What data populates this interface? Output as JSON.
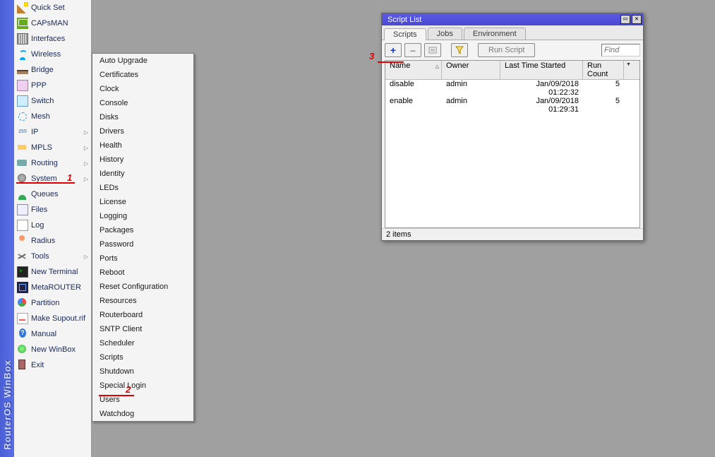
{
  "brand": "RouterOS WinBox",
  "sidebar": [
    {
      "label": "Quick Set",
      "icon": "ic-wand",
      "arrow": false
    },
    {
      "label": "CAPsMAN",
      "icon": "ic-cap",
      "arrow": false
    },
    {
      "label": "Interfaces",
      "icon": "ic-ifc",
      "arrow": false
    },
    {
      "label": "Wireless",
      "icon": "ic-wifi",
      "arrow": false
    },
    {
      "label": "Bridge",
      "icon": "ic-bridge",
      "arrow": false
    },
    {
      "label": "PPP",
      "icon": "ic-ppp",
      "arrow": false
    },
    {
      "label": "Switch",
      "icon": "ic-switch",
      "arrow": false
    },
    {
      "label": "Mesh",
      "icon": "ic-mesh",
      "arrow": false
    },
    {
      "label": "IP",
      "icon": "ic-ip",
      "arrow": true
    },
    {
      "label": "MPLS",
      "icon": "ic-mpls",
      "arrow": true
    },
    {
      "label": "Routing",
      "icon": "ic-route",
      "arrow": true
    },
    {
      "label": "System",
      "icon": "ic-sys",
      "arrow": true
    },
    {
      "label": "Queues",
      "icon": "ic-queue",
      "arrow": false
    },
    {
      "label": "Files",
      "icon": "ic-files",
      "arrow": false
    },
    {
      "label": "Log",
      "icon": "ic-log",
      "arrow": false
    },
    {
      "label": "Radius",
      "icon": "ic-radius",
      "arrow": false
    },
    {
      "label": "Tools",
      "icon": "ic-tools",
      "arrow": true
    },
    {
      "label": "New Terminal",
      "icon": "ic-term",
      "arrow": false
    },
    {
      "label": "MetaROUTER",
      "icon": "ic-meta",
      "arrow": false
    },
    {
      "label": "Partition",
      "icon": "ic-part",
      "arrow": false
    },
    {
      "label": "Make Supout.rif",
      "icon": "ic-make",
      "arrow": false
    },
    {
      "label": "Manual",
      "icon": "ic-man",
      "arrow": false
    },
    {
      "label": "New WinBox",
      "icon": "ic-new",
      "arrow": false
    },
    {
      "label": "Exit",
      "icon": "ic-exit",
      "arrow": false
    }
  ],
  "submenu": [
    "Auto Upgrade",
    "Certificates",
    "Clock",
    "Console",
    "Disks",
    "Drivers",
    "Health",
    "History",
    "Identity",
    "LEDs",
    "License",
    "Logging",
    "Packages",
    "Password",
    "Ports",
    "Reboot",
    "Reset Configuration",
    "Resources",
    "Routerboard",
    "SNTP Client",
    "Scheduler",
    "Scripts",
    "Shutdown",
    "Special Login",
    "Users",
    "Watchdog"
  ],
  "window": {
    "title": "Script List",
    "tabs": [
      "Scripts",
      "Jobs",
      "Environment"
    ],
    "active_tab": 0,
    "toolbar": {
      "plus": "+",
      "minus": "–",
      "note_icon": "✎",
      "funnel_icon": "funnel",
      "run": "Run Script",
      "find_placeholder": "Find"
    },
    "columns": [
      "Name",
      "Owner",
      "Last Time Started",
      "Run Count"
    ],
    "rows": [
      {
        "name": "disable",
        "owner": "admin",
        "last": "Jan/09/2018 01:22:32",
        "count": "5"
      },
      {
        "name": "enable",
        "owner": "admin",
        "last": "Jan/09/2018 01:29:31",
        "count": "5"
      }
    ],
    "status": "2 items"
  },
  "annotations": {
    "one": "1",
    "two": "2",
    "three": "3"
  }
}
